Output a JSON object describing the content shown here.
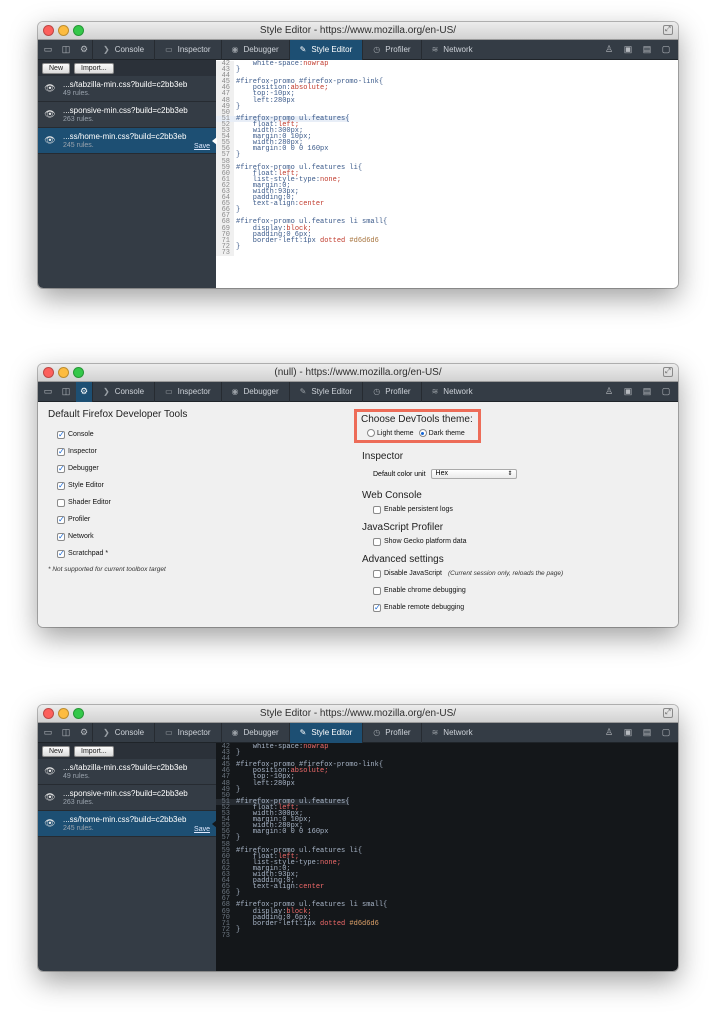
{
  "windows": {
    "style_editor_light": {
      "title": "Style Editor - https://www.mozilla.org/en-US/"
    },
    "options": {
      "title": "(null) - https://www.mozilla.org/en-US/"
    },
    "style_editor_dark": {
      "title": "Style Editor - https://www.mozilla.org/en-US/"
    }
  },
  "toolbar": {
    "tabs": [
      "Console",
      "Inspector",
      "Debugger",
      "Style Editor",
      "Profiler",
      "Network"
    ]
  },
  "style_editor": {
    "new_label": "New",
    "import_label": "Import...",
    "sheets": [
      {
        "name": "...s/tabzilla-min.css?build=c2bb3eb",
        "rules": "49 rules."
      },
      {
        "name": "...sponsive-min.css?build=c2bb3eb",
        "rules": "263 rules."
      },
      {
        "name": "...ss/home-min.css?build=c2bb3eb",
        "rules": "245 rules.",
        "save": "Save"
      }
    ],
    "code": [
      {
        "n": "42",
        "t": "    white-space:",
        "v": "nowrap"
      },
      {
        "n": "43",
        "t": "}"
      },
      {
        "n": "44",
        "t": ""
      },
      {
        "n": "45",
        "t": "#firefox-promo #firefox-promo-link{"
      },
      {
        "n": "46",
        "t": "    position:",
        "v": "absolute;"
      },
      {
        "n": "47",
        "t": "    top:-10px;"
      },
      {
        "n": "48",
        "t": "    left:280px"
      },
      {
        "n": "49",
        "t": "}"
      },
      {
        "n": "50",
        "t": ""
      },
      {
        "n": "51",
        "t": "#firefox-promo ul.features{",
        "cur": true
      },
      {
        "n": "52",
        "t": "    float:",
        "v": "left;"
      },
      {
        "n": "53",
        "t": "    width:300px;"
      },
      {
        "n": "54",
        "t": "    margin:0 10px;"
      },
      {
        "n": "55",
        "t": "    width:280px;"
      },
      {
        "n": "56",
        "t": "    margin:0 0 0 160px"
      },
      {
        "n": "57",
        "t": "}"
      },
      {
        "n": "58",
        "t": ""
      },
      {
        "n": "59",
        "t": "#firefox-promo ul.features li{"
      },
      {
        "n": "60",
        "t": "    float:",
        "v": "left;"
      },
      {
        "n": "61",
        "t": "    list-style-type:",
        "v": "none;"
      },
      {
        "n": "62",
        "t": "    margin:0;"
      },
      {
        "n": "63",
        "t": "    width:93px;"
      },
      {
        "n": "64",
        "t": "    padding:0;"
      },
      {
        "n": "65",
        "t": "    text-align:",
        "v": "center"
      },
      {
        "n": "66",
        "t": "}"
      },
      {
        "n": "67",
        "t": ""
      },
      {
        "n": "68",
        "t": "#firefox-promo ul.features li small{"
      },
      {
        "n": "69",
        "t": "    display:",
        "v": "block;"
      },
      {
        "n": "70",
        "t": "    padding:0 6px;"
      },
      {
        "n": "71",
        "t": "    border-left:1px ",
        "v": "dotted ",
        "c": "#d6d6d6"
      },
      {
        "n": "72",
        "t": "}"
      },
      {
        "n": "73",
        "t": ""
      }
    ]
  },
  "options": {
    "default_tools_heading": "Default Firefox Developer Tools",
    "tools": [
      {
        "label": "Console",
        "checked": true
      },
      {
        "label": "Inspector",
        "checked": true
      },
      {
        "label": "Debugger",
        "checked": true
      },
      {
        "label": "Style Editor",
        "checked": true
      },
      {
        "label": "Shader Editor",
        "checked": false
      },
      {
        "label": "Profiler",
        "checked": true
      },
      {
        "label": "Network",
        "checked": true
      },
      {
        "label": "Scratchpad *",
        "checked": true
      }
    ],
    "not_supported_note": "* Not supported for current toolbox target",
    "theme_heading": "Choose DevTools theme:",
    "light_theme": "Light theme",
    "dark_theme": "Dark theme",
    "inspector_heading": "Inspector",
    "color_unit_label": "Default color unit",
    "color_unit_value": "Hex",
    "web_console_heading": "Web Console",
    "persistent_logs": "Enable persistent logs",
    "profiler_heading": "JavaScript Profiler",
    "gecko_data": "Show Gecko platform data",
    "advanced_heading": "Advanced settings",
    "disable_js": "Disable JavaScript",
    "disable_js_note": "(Current session only, reloads the page)",
    "chrome_debugging": "Enable chrome debugging",
    "remote_debugging": "Enable remote debugging"
  },
  "colors": {
    "accent": "#1d4f73",
    "toolbar": "#343c45",
    "highlight": "#ed6c58"
  }
}
